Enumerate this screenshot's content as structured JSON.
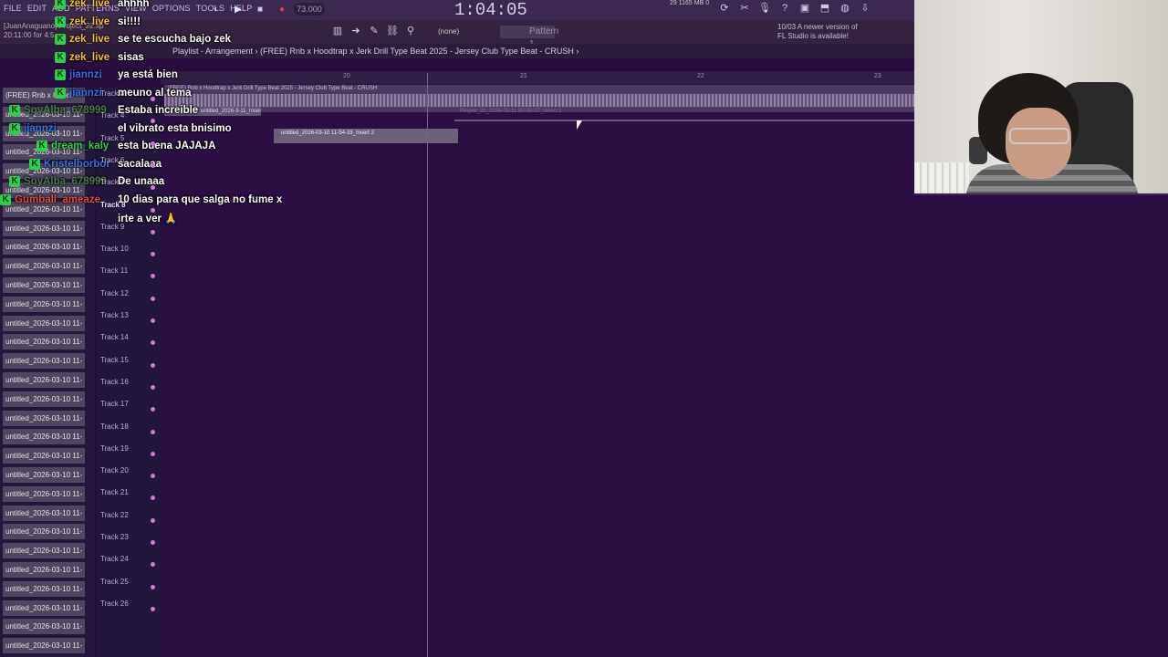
{
  "menu": [
    "FILE",
    "EDIT",
    "ADD",
    "PATTERNS",
    "VIEW",
    "OPTIONS",
    "TOOLS",
    "HELP"
  ],
  "transport": {
    "tempo": "73.000",
    "time": "1:04:05"
  },
  "info": {
    "line1": "[JuanAnaguano] Project_22.flp",
    "line2": "20:11:00 for 4:5"
  },
  "memory": {
    "mb": "1165 MB",
    "zero": "0",
    "cpu": "29"
  },
  "toolbar": {
    "none_label": "(none)",
    "pattern_label": "Pattern 1"
  },
  "notice": {
    "line1": "10/03  A newer version of",
    "line2": "FL Studio is available!"
  },
  "breadcrumb": {
    "text": "Playlist - Arrangement › (FREE) Rnb x Hoodtrap x Jerk Drill Type Beat 2025 - Jersey Club Type Beat - CRUSH ›"
  },
  "ruler": {
    "n20": "20",
    "n21": "21",
    "n22": "22",
    "n23": "23"
  },
  "clips": {
    "main": "(FREE) Rnb x Hoodtrap x Jerk Drill Type Beat 2025 - Jersey Club Type Beat - CRUSH",
    "c2": "untitled_2026-3-11_Insert 2",
    "c3": "Project_22_2026-03-11 00-00-27_Insert 2",
    "c4": "untitled_2026-03-10 11-54-33_Insert 2"
  },
  "browser": {
    "first": "(FREE) Rnb x Hoodt",
    "item": "untitled_2026-03-10 11-"
  },
  "tracks": [
    "Track 3",
    "Track 4",
    "Track 5",
    "Track 6",
    "Track 7",
    "Track 8",
    "Track 9",
    "Track 10",
    "Track 11",
    "Track 12",
    "Track 13",
    "Track 14",
    "Track 15",
    "Track 16",
    "Track 17",
    "Track 18",
    "Track 19",
    "Track 20",
    "Track 21",
    "Track 22",
    "Track 23",
    "Track 24",
    "Track 25",
    "Track 26"
  ],
  "chat": [
    {
      "user": "zek_live",
      "msg": "ahhhh",
      "color": "#f0c020",
      "badge": true
    },
    {
      "user": "zek_live",
      "msg": "si!!!!",
      "color": "#f0c020",
      "badge": true
    },
    {
      "user": "zek_live",
      "msg": "se te escucha bajo zek",
      "color": "#f0c020",
      "badge": true
    },
    {
      "user": "zek_live",
      "msg": "sisas",
      "color": "#f0c020",
      "badge": true
    },
    {
      "user": "jiannzi",
      "msg": "ya está bien",
      "color": "#3a6ee8",
      "badge": true
    },
    {
      "user": "jiannzi",
      "msg": "meuno al tema",
      "color": "#3a6ee8",
      "badge": true
    },
    {
      "user": "SoyAlba_678999",
      "msg": "Estaba increible",
      "color": "#4a7a4a",
      "badge": true
    },
    {
      "user": "jiannzi",
      "msg": "el vibrato esta bnisimo",
      "color": "#3a6ee8",
      "badge": true
    },
    {
      "user": "dream_kaly",
      "msg": "esta buena JAJAJA",
      "color": "#2bd14a",
      "badge": true
    },
    {
      "user": "Kristelborbor",
      "msg": "sacalaaa",
      "color": "#3a6ee8",
      "badge": true
    },
    {
      "user": "SoyAlba_678999",
      "msg": "De unaaa",
      "color": "#4a7a4a",
      "badge": true
    },
    {
      "user": "Gumball_ameaze",
      "msg": "10 dias para que salga no fume x",
      "color": "#e04a4a",
      "badge": true
    },
    {
      "user": "",
      "msg": "irte a ver 🙏",
      "color": "#ffffff",
      "badge": false
    }
  ],
  "colors": {
    "accent": "#c77cd6",
    "background": "#2a0d3f",
    "badge": "#2bd14a"
  }
}
